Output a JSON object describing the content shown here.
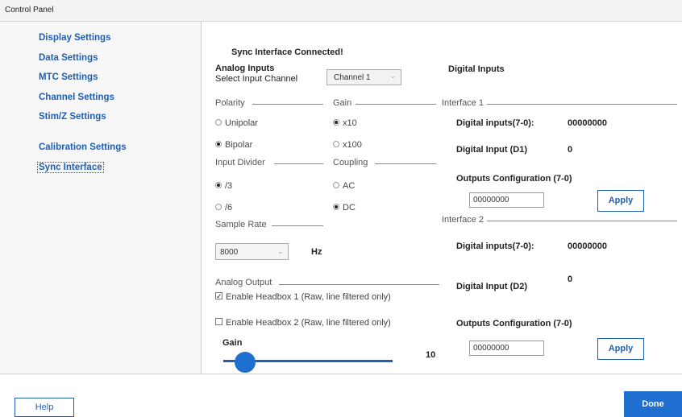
{
  "window": {
    "title": "Control Panel"
  },
  "sidebar": {
    "items": [
      {
        "label": "Display Settings"
      },
      {
        "label": "Data Settings"
      },
      {
        "label": "MTC Settings"
      },
      {
        "label": "Channel Settings"
      },
      {
        "label": "Stim/Z Settings"
      },
      {
        "label": "Calibration Settings"
      },
      {
        "label": "Sync Interface",
        "selected": true
      }
    ]
  },
  "main": {
    "status": "Sync Interface Connected!",
    "analog": {
      "heading": "Analog Inputs",
      "select_label": "Select Input Channel",
      "channel_value": "Channel 1",
      "polarity": {
        "label": "Polarity",
        "options": [
          "Unipolar",
          "Bipolar"
        ],
        "selected": "Bipolar"
      },
      "gain": {
        "label": "Gain",
        "options": [
          "x10",
          "x100"
        ],
        "selected": "x10"
      },
      "divider": {
        "label": "Input Divider",
        "options": [
          "/3",
          "/6"
        ],
        "selected": "/3"
      },
      "coupling": {
        "label": "Coupling",
        "options": [
          "AC",
          "DC"
        ],
        "selected": "DC"
      },
      "sample_rate": {
        "label": "Sample Rate",
        "value": "8000",
        "unit": "Hz"
      }
    },
    "analog_output": {
      "label": "Analog Output",
      "headbox1": {
        "label": "Enable Headbox 1 (Raw, line filtered only)",
        "checked": true
      },
      "headbox2": {
        "label": "Enable Headbox 2 (Raw, line filtered only)",
        "checked": false
      },
      "gain_label": "Gain",
      "gain_value": "10"
    },
    "digital": {
      "heading": "Digital Inputs",
      "interface1": {
        "label": "Interface 1",
        "inputs_label": "Digital inputs(7-0):",
        "inputs_value": "00000000",
        "input_d_label": "Digital Input (D1)",
        "input_d_value": "0",
        "outputs_label": "Outputs Configuration (7-0)",
        "outputs_value": "00000000",
        "apply_label": "Apply"
      },
      "interface2": {
        "label": "Interface 2",
        "inputs_label": "Digital inputs(7-0):",
        "inputs_value": "00000000",
        "input_d_label": "Digital Input (D2)",
        "input_d_value": "0",
        "outputs_label": "Outputs Configuration (7-0)",
        "outputs_value": "00000000",
        "apply_label": "Apply"
      }
    }
  },
  "footer": {
    "help_label": "Help",
    "done_label": "Done"
  },
  "colors": {
    "accent": "#1f6fd1",
    "link": "#1f5fb3"
  }
}
